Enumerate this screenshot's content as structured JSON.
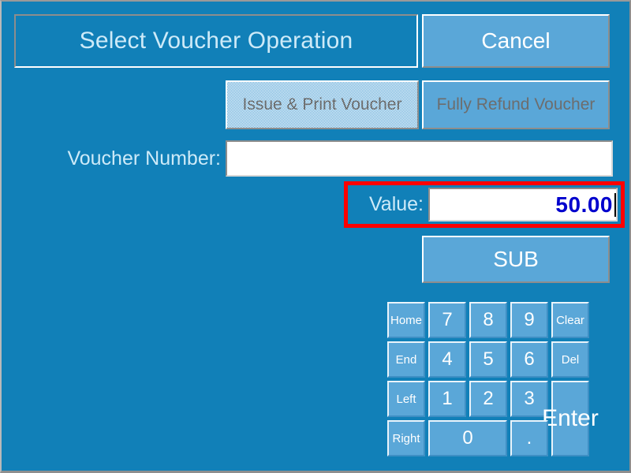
{
  "window": {
    "title": "Select Voucher Operation",
    "background_color": "#1180b8",
    "button_color": "#5aa7d8",
    "highlight_color": "#ff0000",
    "value_text_color": "#0000cd"
  },
  "header": {
    "title": "Select Voucher Operation",
    "cancel_label": "Cancel"
  },
  "operations": {
    "issue_print_label": "Issue & Print Voucher",
    "fully_refund_label": "Fully Refund Voucher"
  },
  "fields": {
    "voucher_number": {
      "label": "Voucher Number:",
      "value": "",
      "placeholder": ""
    },
    "value": {
      "label": "Value:",
      "value": "50.00",
      "placeholder": ""
    }
  },
  "actions": {
    "sub_label": "SUB"
  },
  "keypad": {
    "rows": [
      [
        {
          "label": "Home",
          "name": "key-home",
          "kind": "nav"
        },
        {
          "label": "7",
          "name": "key-7",
          "kind": "digit"
        },
        {
          "label": "8",
          "name": "key-8",
          "kind": "digit"
        },
        {
          "label": "9",
          "name": "key-9",
          "kind": "digit"
        },
        {
          "label": "Clear",
          "name": "key-clear",
          "kind": "fn"
        }
      ],
      [
        {
          "label": "End",
          "name": "key-end",
          "kind": "nav"
        },
        {
          "label": "4",
          "name": "key-4",
          "kind": "digit"
        },
        {
          "label": "5",
          "name": "key-5",
          "kind": "digit"
        },
        {
          "label": "6",
          "name": "key-6",
          "kind": "digit"
        },
        {
          "label": "Del",
          "name": "key-del",
          "kind": "fn"
        }
      ],
      [
        {
          "label": "Left",
          "name": "key-left",
          "kind": "nav"
        },
        {
          "label": "1",
          "name": "key-1",
          "kind": "digit"
        },
        {
          "label": "2",
          "name": "key-2",
          "kind": "digit"
        },
        {
          "label": "3",
          "name": "key-3",
          "kind": "digit"
        },
        {
          "label": "Enter",
          "name": "key-enter",
          "kind": "enter"
        }
      ],
      [
        {
          "label": "Right",
          "name": "key-right",
          "kind": "nav"
        },
        {
          "label": "0",
          "name": "key-0",
          "kind": "digit"
        },
        {
          "label": ".",
          "name": "key-dot",
          "kind": "digit"
        }
      ]
    ]
  }
}
